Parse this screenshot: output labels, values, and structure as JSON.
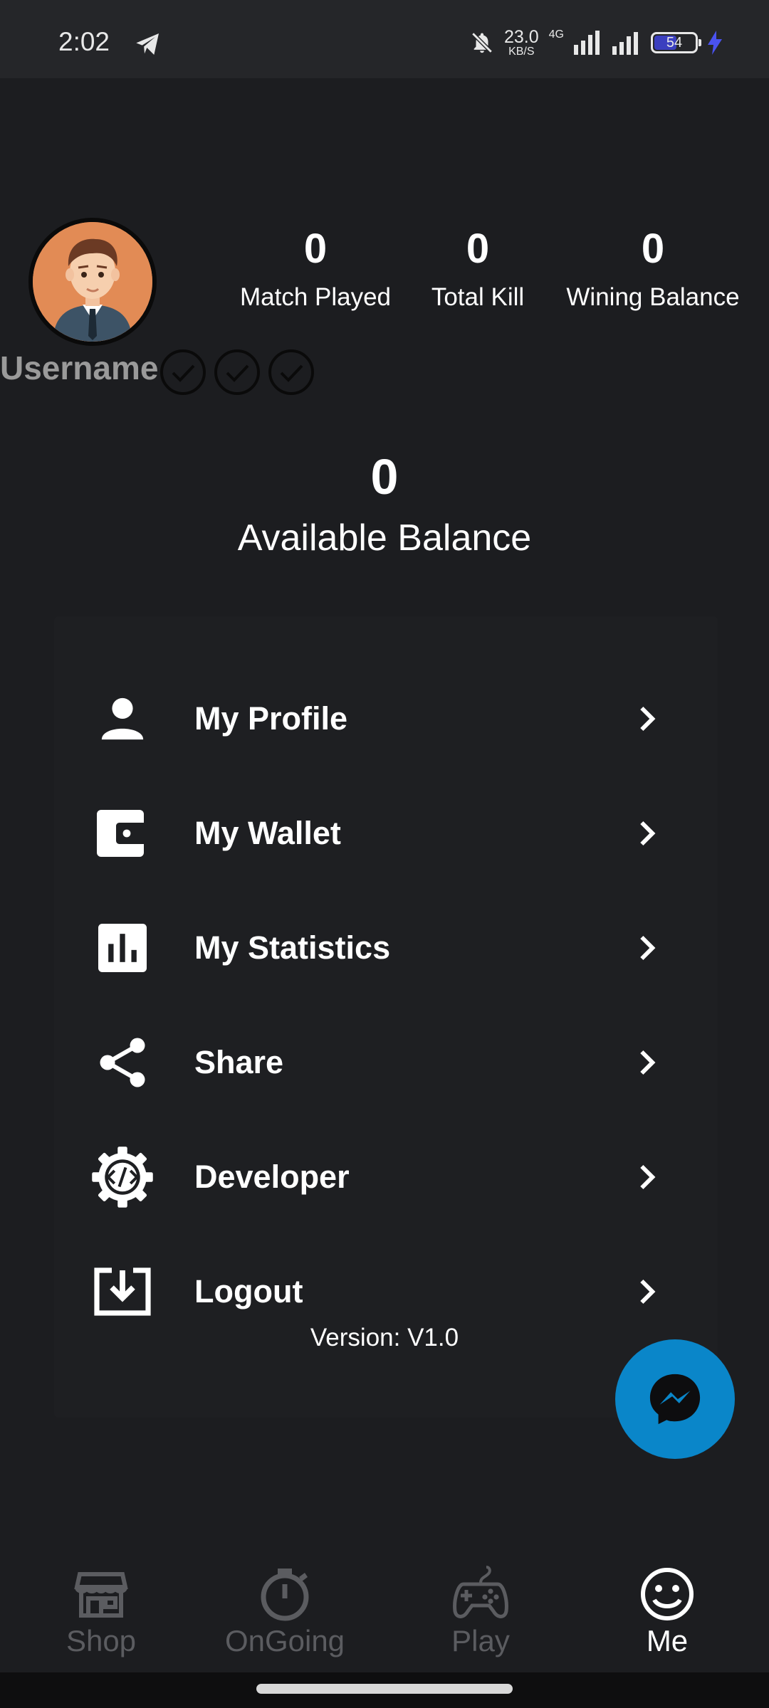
{
  "status_bar": {
    "time": "2:02",
    "speed_value": "23.0",
    "speed_unit": "KB/S",
    "network": "4G",
    "battery": "54"
  },
  "profile": {
    "username": "Username",
    "stats": [
      {
        "value": "0",
        "label": "Match Played"
      },
      {
        "value": "0",
        "label": "Total Kill"
      },
      {
        "value": "0",
        "label": "Wining Balance"
      }
    ]
  },
  "balance": {
    "value": "0",
    "label": "Available Balance"
  },
  "menu": {
    "items": [
      {
        "label": "My Profile",
        "icon": "person-icon"
      },
      {
        "label": "My Wallet",
        "icon": "wallet-icon"
      },
      {
        "label": "My Statistics",
        "icon": "bar-chart-icon"
      },
      {
        "label": "Share",
        "icon": "share-icon"
      },
      {
        "label": "Developer",
        "icon": "developer-gear-icon"
      },
      {
        "label": "Logout",
        "icon": "logout-icon"
      }
    ]
  },
  "version": "Version: V1.0",
  "bottom_nav": {
    "items": [
      {
        "label": "Shop",
        "icon": "shop-icon",
        "active": false
      },
      {
        "label": "OnGoing",
        "icon": "stopwatch-icon",
        "active": false
      },
      {
        "label": "Play",
        "icon": "gamepad-icon",
        "active": false
      },
      {
        "label": "Me",
        "icon": "smiley-icon",
        "active": true
      }
    ]
  },
  "colors": {
    "background": "#1c1d20",
    "fab": "#0a86c9",
    "inactive_nav": "#5b5c60",
    "avatar_bg": "#e28b55"
  }
}
